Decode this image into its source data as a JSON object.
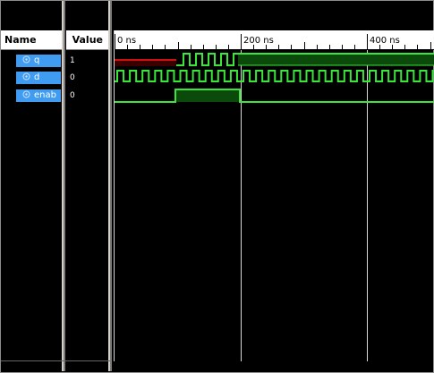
{
  "columns": {
    "name": "Name",
    "value": "Value"
  },
  "signals": [
    {
      "name": "q",
      "value": "1"
    },
    {
      "name": "d",
      "value": "0"
    },
    {
      "name": "enab",
      "value": "0"
    }
  ],
  "timeline": {
    "ticks": [
      "0 ns",
      "200 ns",
      "400 ns"
    ]
  },
  "colors": {
    "wave": "#39e639",
    "bus_fill": "#0b4a0b",
    "undefined": "#d01010",
    "cursor": "#d9d9d9"
  }
}
